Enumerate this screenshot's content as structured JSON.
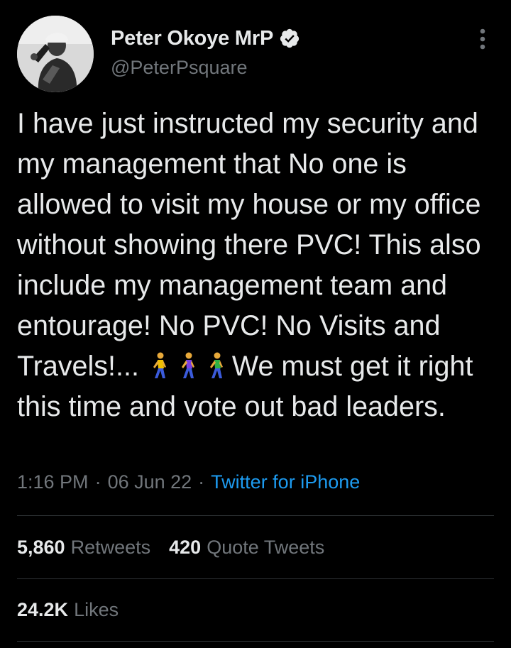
{
  "author": {
    "display_name": "Peter Okoye MrP",
    "handle": "@PeterPsquare",
    "verified_icon": "verified-badge-icon",
    "avatar_icon": "profile-avatar"
  },
  "menu": {
    "icon": "more-vertical-icon"
  },
  "tweet": {
    "text_part1": "I have just instructed my security and my management that No one is allowed to visit my house or my office without showing there PVC! This also include my management team and entourage! No PVC! No Visits and Travels!... ",
    "emoji": [
      "person-walking-icon",
      "person-walking-icon",
      "person-walking-icon"
    ],
    "text_part2": "We must get it right this time and vote out bad leaders."
  },
  "meta": {
    "time": "1:16 PM",
    "separator": "·",
    "date": "06 Jun 22",
    "source": "Twitter for iPhone"
  },
  "stats": {
    "retweets_count": "5,860",
    "retweets_label": "Retweets",
    "quotes_count": "420",
    "quotes_label": "Quote Tweets",
    "likes_count": "24.2K",
    "likes_label": "Likes"
  },
  "colors": {
    "background": "#000000",
    "text": "#e7e9ea",
    "secondary": "#71767b",
    "link": "#1d9bf0",
    "divider": "#2f3336"
  }
}
